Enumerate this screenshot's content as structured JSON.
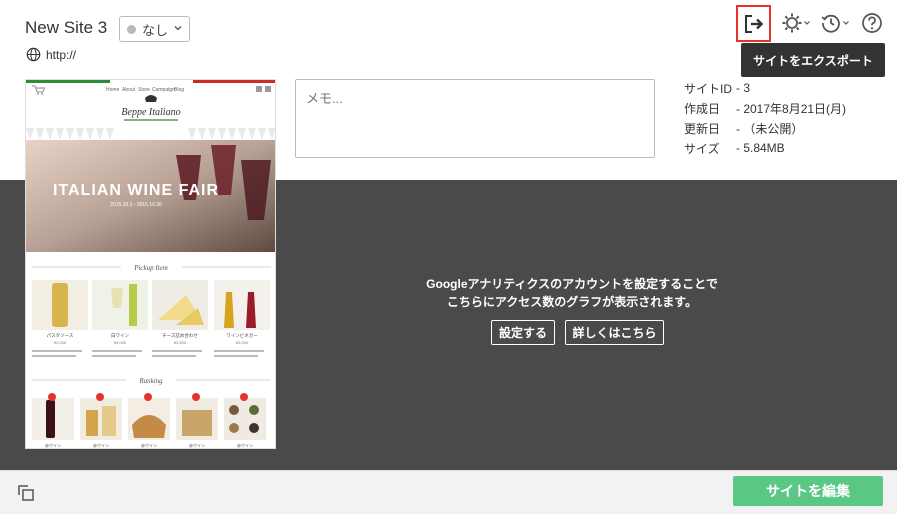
{
  "site": {
    "title": "New Site 3",
    "status": "なし",
    "url": "http://"
  },
  "toolbar": {
    "export_tooltip": "サイトをエクスポート",
    "icons": [
      "export-icon",
      "gear-icon",
      "history-icon",
      "help-icon"
    ],
    "export_highlight_color": "#e8332a"
  },
  "memo": {
    "placeholder": "メモ..."
  },
  "meta": {
    "rows": [
      {
        "label": "サイトID",
        "value": "- 3"
      },
      {
        "label": "作成日",
        "value": "- 2017年8月21日(月)"
      },
      {
        "label": "更新日",
        "value": "- （未公開）"
      },
      {
        "label": "サイズ",
        "value": "- 5.84MB"
      }
    ]
  },
  "analytics": {
    "message_line1": "Googleアナリティクスのアカウントを設定することで",
    "message_line2": "こちらにアクセス数のグラフが表示されます。",
    "setup_label": "設定する",
    "details_label": "詳しくはこちら"
  },
  "preview": {
    "logo": "Beppe Italiano",
    "nav": [
      "Home",
      "About",
      "Store",
      "Campaign",
      "Blog"
    ],
    "hero_title": "ITALIAN WINE FAIR",
    "hero_dates": "2015.10.1 - 2015.10.30",
    "pickup_heading": "Pickup Item",
    "ranking_heading": "Ranking",
    "pickup_items": [
      {
        "name": "パスタソース",
        "price": "¥2,000"
      },
      {
        "name": "白ワイン",
        "price": "¥4,000"
      },
      {
        "name": "チーズ詰め合わせ",
        "price": "¥3,500"
      },
      {
        "name": "ワインビネガー",
        "price": "¥2,000"
      }
    ],
    "ranking_items": [
      "赤ワイン",
      "赤ワイン",
      "赤ワイン",
      "赤ワイン",
      "赤ワイン"
    ]
  },
  "footer": {
    "edit_label": "サイトを編集"
  },
  "colors": {
    "dark_panel": "#4a4a4a",
    "edit_button": "#5bc785"
  }
}
